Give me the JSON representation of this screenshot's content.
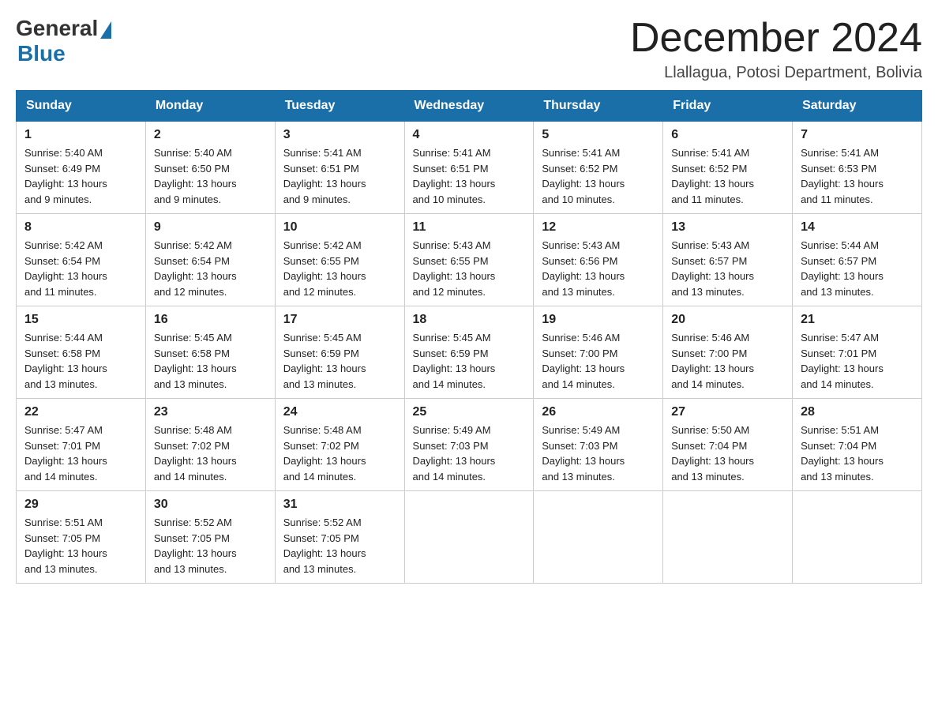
{
  "header": {
    "logo_general": "General",
    "logo_blue": "Blue",
    "month_title": "December 2024",
    "location": "Llallagua, Potosi Department, Bolivia"
  },
  "weekdays": [
    "Sunday",
    "Monday",
    "Tuesday",
    "Wednesday",
    "Thursday",
    "Friday",
    "Saturday"
  ],
  "weeks": [
    [
      {
        "day": "1",
        "sunrise": "5:40 AM",
        "sunset": "6:49 PM",
        "daylight": "13 hours and 9 minutes."
      },
      {
        "day": "2",
        "sunrise": "5:40 AM",
        "sunset": "6:50 PM",
        "daylight": "13 hours and 9 minutes."
      },
      {
        "day": "3",
        "sunrise": "5:41 AM",
        "sunset": "6:51 PM",
        "daylight": "13 hours and 9 minutes."
      },
      {
        "day": "4",
        "sunrise": "5:41 AM",
        "sunset": "6:51 PM",
        "daylight": "13 hours and 10 minutes."
      },
      {
        "day": "5",
        "sunrise": "5:41 AM",
        "sunset": "6:52 PM",
        "daylight": "13 hours and 10 minutes."
      },
      {
        "day": "6",
        "sunrise": "5:41 AM",
        "sunset": "6:52 PM",
        "daylight": "13 hours and 11 minutes."
      },
      {
        "day": "7",
        "sunrise": "5:41 AM",
        "sunset": "6:53 PM",
        "daylight": "13 hours and 11 minutes."
      }
    ],
    [
      {
        "day": "8",
        "sunrise": "5:42 AM",
        "sunset": "6:54 PM",
        "daylight": "13 hours and 11 minutes."
      },
      {
        "day": "9",
        "sunrise": "5:42 AM",
        "sunset": "6:54 PM",
        "daylight": "13 hours and 12 minutes."
      },
      {
        "day": "10",
        "sunrise": "5:42 AM",
        "sunset": "6:55 PM",
        "daylight": "13 hours and 12 minutes."
      },
      {
        "day": "11",
        "sunrise": "5:43 AM",
        "sunset": "6:55 PM",
        "daylight": "13 hours and 12 minutes."
      },
      {
        "day": "12",
        "sunrise": "5:43 AM",
        "sunset": "6:56 PM",
        "daylight": "13 hours and 13 minutes."
      },
      {
        "day": "13",
        "sunrise": "5:43 AM",
        "sunset": "6:57 PM",
        "daylight": "13 hours and 13 minutes."
      },
      {
        "day": "14",
        "sunrise": "5:44 AM",
        "sunset": "6:57 PM",
        "daylight": "13 hours and 13 minutes."
      }
    ],
    [
      {
        "day": "15",
        "sunrise": "5:44 AM",
        "sunset": "6:58 PM",
        "daylight": "13 hours and 13 minutes."
      },
      {
        "day": "16",
        "sunrise": "5:45 AM",
        "sunset": "6:58 PM",
        "daylight": "13 hours and 13 minutes."
      },
      {
        "day": "17",
        "sunrise": "5:45 AM",
        "sunset": "6:59 PM",
        "daylight": "13 hours and 13 minutes."
      },
      {
        "day": "18",
        "sunrise": "5:45 AM",
        "sunset": "6:59 PM",
        "daylight": "13 hours and 14 minutes."
      },
      {
        "day": "19",
        "sunrise": "5:46 AM",
        "sunset": "7:00 PM",
        "daylight": "13 hours and 14 minutes."
      },
      {
        "day": "20",
        "sunrise": "5:46 AM",
        "sunset": "7:00 PM",
        "daylight": "13 hours and 14 minutes."
      },
      {
        "day": "21",
        "sunrise": "5:47 AM",
        "sunset": "7:01 PM",
        "daylight": "13 hours and 14 minutes."
      }
    ],
    [
      {
        "day": "22",
        "sunrise": "5:47 AM",
        "sunset": "7:01 PM",
        "daylight": "13 hours and 14 minutes."
      },
      {
        "day": "23",
        "sunrise": "5:48 AM",
        "sunset": "7:02 PM",
        "daylight": "13 hours and 14 minutes."
      },
      {
        "day": "24",
        "sunrise": "5:48 AM",
        "sunset": "7:02 PM",
        "daylight": "13 hours and 14 minutes."
      },
      {
        "day": "25",
        "sunrise": "5:49 AM",
        "sunset": "7:03 PM",
        "daylight": "13 hours and 14 minutes."
      },
      {
        "day": "26",
        "sunrise": "5:49 AM",
        "sunset": "7:03 PM",
        "daylight": "13 hours and 13 minutes."
      },
      {
        "day": "27",
        "sunrise": "5:50 AM",
        "sunset": "7:04 PM",
        "daylight": "13 hours and 13 minutes."
      },
      {
        "day": "28",
        "sunrise": "5:51 AM",
        "sunset": "7:04 PM",
        "daylight": "13 hours and 13 minutes."
      }
    ],
    [
      {
        "day": "29",
        "sunrise": "5:51 AM",
        "sunset": "7:05 PM",
        "daylight": "13 hours and 13 minutes."
      },
      {
        "day": "30",
        "sunrise": "5:52 AM",
        "sunset": "7:05 PM",
        "daylight": "13 hours and 13 minutes."
      },
      {
        "day": "31",
        "sunrise": "5:52 AM",
        "sunset": "7:05 PM",
        "daylight": "13 hours and 13 minutes."
      },
      null,
      null,
      null,
      null
    ]
  ],
  "labels": {
    "sunrise": "Sunrise:",
    "sunset": "Sunset:",
    "daylight": "Daylight:"
  }
}
